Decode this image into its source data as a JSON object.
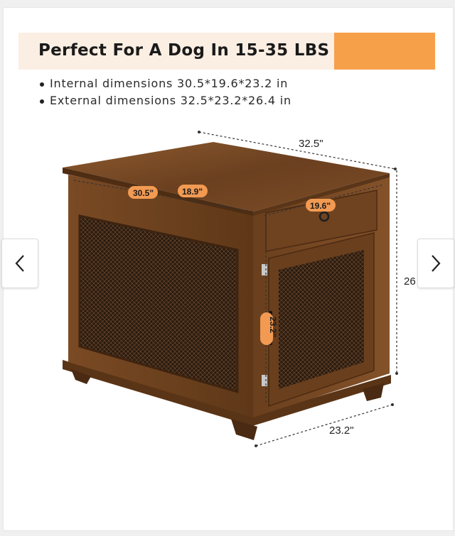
{
  "heading": "Perfect For A Dog In 15-35 LBS",
  "bullets": [
    "Internal dimensions 30.5*19.6*23.2 in",
    "External dimensions 32.5*23.2*26.4 in"
  ],
  "dimensions": {
    "outer_width": "32.5\"",
    "outer_depth": "23.2\"",
    "outer_height": "26",
    "inner_width": "30.5\"",
    "inner_depth_top": "18.9\"",
    "inner_depth": "19.6\"",
    "inner_height": "23.2\""
  },
  "colors": {
    "accent": "#f7a04a",
    "label_tag": "#f29a52",
    "banner": "#fbeee2",
    "wood": "#7a4a24"
  },
  "icons": {
    "prev": "chevron-left-icon",
    "next": "chevron-right-icon"
  }
}
